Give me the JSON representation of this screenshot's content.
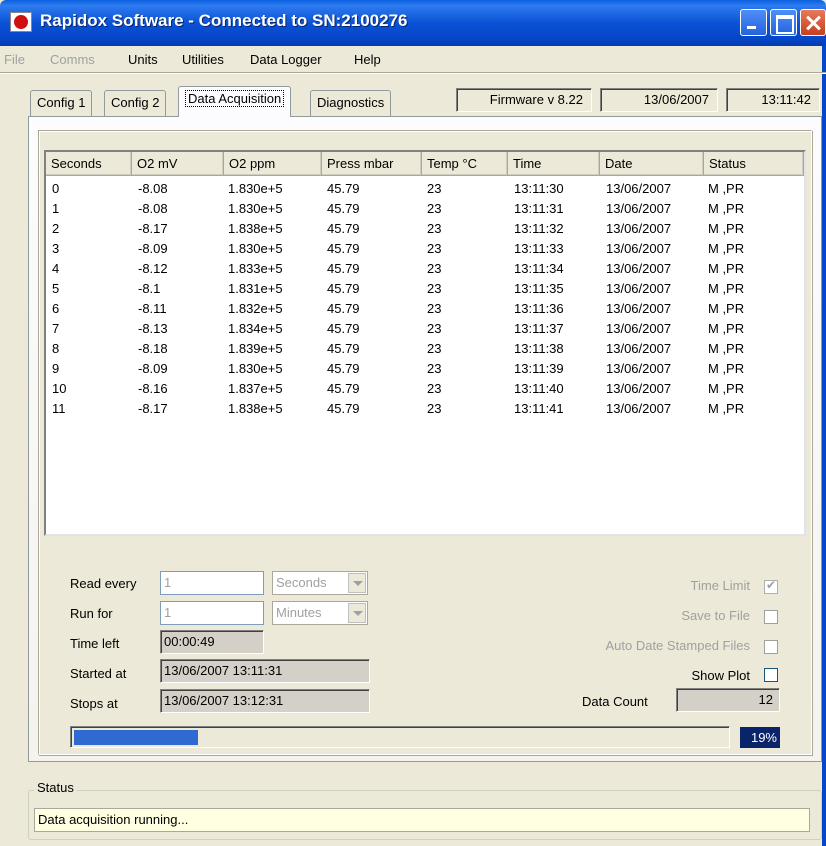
{
  "window": {
    "title": "Rapidox Software - Connected to SN:2100276"
  },
  "menu": [
    {
      "label": "File",
      "enabled": false
    },
    {
      "label": "Comms",
      "enabled": false
    },
    {
      "label": "Units",
      "enabled": true
    },
    {
      "label": "Utilities",
      "enabled": true
    },
    {
      "label": "Data Logger",
      "enabled": true
    },
    {
      "label": "Help",
      "enabled": true
    }
  ],
  "tabs": [
    {
      "label": "Config 1",
      "active": false
    },
    {
      "label": "Config 2",
      "active": false
    },
    {
      "label": "Data Acquisition",
      "active": true
    },
    {
      "label": "Diagnostics",
      "active": false
    }
  ],
  "info": {
    "firmware": "Firmware v 8.22",
    "date": "13/06/2007",
    "time": "13:11:42"
  },
  "grid": {
    "columns": [
      "Seconds",
      "O2 mV",
      "O2 ppm",
      "Press mbar",
      "Temp °C",
      "Time",
      "Date",
      "Status"
    ],
    "rows": [
      [
        "0",
        "-8.08",
        "1.830e+5",
        "45.79",
        "23",
        "13:11:30",
        "13/06/2007",
        "M ,PR"
      ],
      [
        "1",
        "-8.08",
        "1.830e+5",
        "45.79",
        "23",
        "13:11:31",
        "13/06/2007",
        "M ,PR"
      ],
      [
        "2",
        "-8.17",
        "1.838e+5",
        "45.79",
        "23",
        "13:11:32",
        "13/06/2007",
        "M ,PR"
      ],
      [
        "3",
        "-8.09",
        "1.830e+5",
        "45.79",
        "23",
        "13:11:33",
        "13/06/2007",
        "M ,PR"
      ],
      [
        "4",
        "-8.12",
        "1.833e+5",
        "45.79",
        "23",
        "13:11:34",
        "13/06/2007",
        "M ,PR"
      ],
      [
        "5",
        "-8.1",
        "1.831e+5",
        "45.79",
        "23",
        "13:11:35",
        "13/06/2007",
        "M ,PR"
      ],
      [
        "6",
        "-8.11",
        "1.832e+5",
        "45.79",
        "23",
        "13:11:36",
        "13/06/2007",
        "M ,PR"
      ],
      [
        "7",
        "-8.13",
        "1.834e+5",
        "45.79",
        "23",
        "13:11:37",
        "13/06/2007",
        "M ,PR"
      ],
      [
        "8",
        "-8.18",
        "1.839e+5",
        "45.79",
        "23",
        "13:11:38",
        "13/06/2007",
        "M ,PR"
      ],
      [
        "9",
        "-8.09",
        "1.830e+5",
        "45.79",
        "23",
        "13:11:39",
        "13/06/2007",
        "M ,PR"
      ],
      [
        "10",
        "-8.16",
        "1.837e+5",
        "45.79",
        "23",
        "13:11:40",
        "13/06/2007",
        "M ,PR"
      ],
      [
        "11",
        "-8.17",
        "1.838e+5",
        "45.79",
        "23",
        "13:11:41",
        "13/06/2007",
        "M ,PR"
      ]
    ]
  },
  "controls": {
    "read_every_label": "Read every",
    "read_every_value": "1",
    "read_every_unit": "Seconds",
    "run_for_label": "Run for",
    "run_for_value": "1",
    "run_for_unit": "Minutes",
    "time_left_label": "Time left",
    "time_left_value": "00:00:49",
    "started_at_label": "Started at",
    "started_at_value": "13/06/2007 13:11:31",
    "stops_at_label": "Stops at",
    "stops_at_value": "13/06/2007 13:12:31",
    "time_limit_label": "Time Limit",
    "time_limit_checked": true,
    "save_to_file_label": "Save to File",
    "save_to_file_checked": false,
    "auto_date_label": "Auto Date Stamped Files",
    "auto_date_checked": false,
    "show_plot_label": "Show Plot",
    "show_plot_checked": false,
    "data_count_label": "Data Count",
    "data_count_value": "12"
  },
  "progress": {
    "percent_text": "19%",
    "fraction": 0.19
  },
  "status": {
    "caption": "Status",
    "text": "Data acquisition running..."
  },
  "colors": {
    "titlebar": "#0a52d6",
    "progress_fill": "#3069d0",
    "status_bg": "#ffffe1"
  }
}
